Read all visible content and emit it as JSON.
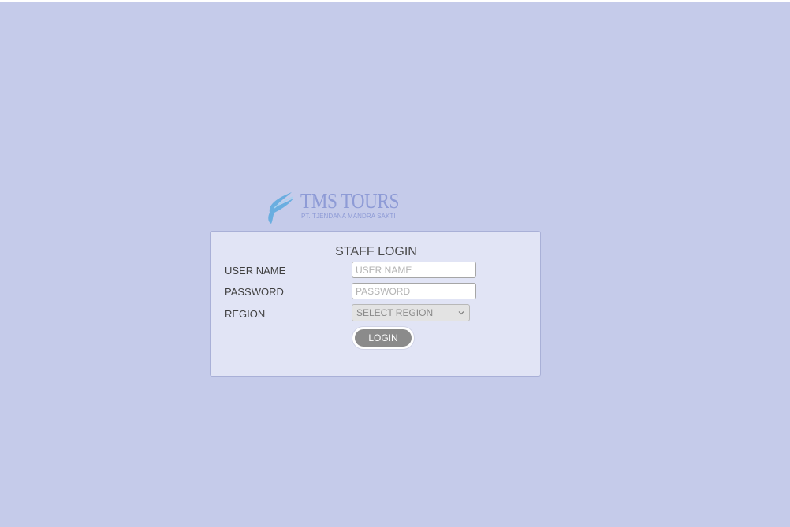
{
  "brand": {
    "name": "TMS TOURS",
    "company": "PT. TJENDANA MANDRA SAKTI",
    "color": "#8e9bd6",
    "mark_color": "#6aaee0"
  },
  "page": {
    "background": "#c5cbea"
  },
  "login_form": {
    "title": "STAFF LOGIN",
    "username": {
      "label": "USER NAME",
      "placeholder": "USER NAME",
      "value": ""
    },
    "password": {
      "label": "PASSWORD",
      "placeholder": "PASSWORD",
      "value": ""
    },
    "region": {
      "label": "REGION",
      "selected": "SELECT REGION",
      "icon": "chevron-down-icon"
    },
    "submit_label": "LOGIN"
  }
}
